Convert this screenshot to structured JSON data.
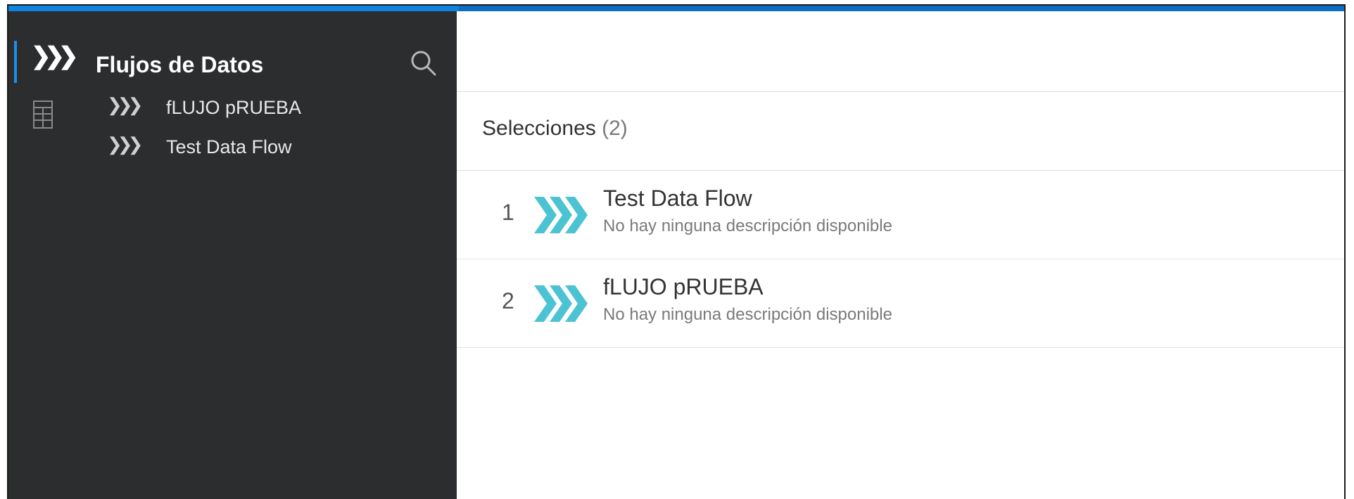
{
  "sidebar": {
    "title": "Flujos de Datos",
    "rail_icons": [
      "data-flow-icon",
      "table-grid-icon"
    ],
    "tree_items": [
      {
        "label": "fLUJO pRUEBA",
        "icon": "chevrons-icon"
      },
      {
        "label": "Test Data Flow",
        "icon": "chevrons-icon"
      }
    ]
  },
  "glyphs": {
    "chevrons": "❯❯❯"
  },
  "main": {
    "selections_label": "Selecciones",
    "selections_count": "(2)",
    "rows": [
      {
        "index": "1",
        "name": "Test Data Flow",
        "description": "No hay ninguna descripción disponible"
      },
      {
        "index": "2",
        "name": "fLUJO pRUEBA",
        "description": "No hay ninguna descripción disponible"
      }
    ]
  },
  "colors": {
    "accent_blue": "#0d84e0",
    "sidebar_bg": "#2c2d2f",
    "flow_icon": "#4bc3d3"
  }
}
